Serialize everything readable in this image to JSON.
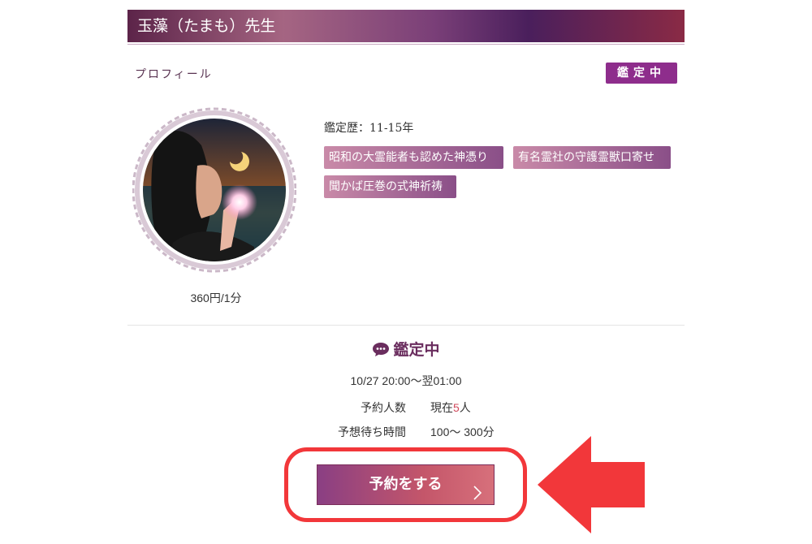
{
  "header": {
    "title": "玉藻（たまも）先生"
  },
  "profile": {
    "label": "プロフィール",
    "status_badge": "鑑定中"
  },
  "fortune_teller": {
    "price": "360円/1分",
    "experience": "鑑定歴：11-15年",
    "tags": [
      "昭和の大霊能者も認めた神憑り",
      "有名霊社の守護霊獣口寄せ",
      "聞かば圧巻の式神祈祷"
    ]
  },
  "status_section": {
    "heading": "鑑定中",
    "schedule": "10/27 20:00〜翌01:00",
    "reservation_count_label": "予約人数",
    "reservation_count_prefix": "現在",
    "reservation_count_number": "5",
    "reservation_count_suffix": "人",
    "wait_time_label": "予想待ち時間",
    "wait_time_value": "100〜 300分"
  },
  "reserve_button": {
    "label": "予約をする"
  },
  "icons": {
    "status": "chat-bubble-icon",
    "button_chevron": "chevron-right-icon",
    "annotation": "red-arrow-left"
  },
  "colors": {
    "accent": "#8e2d8c",
    "highlight": "#f2373a",
    "count_number": "#d0485b"
  }
}
